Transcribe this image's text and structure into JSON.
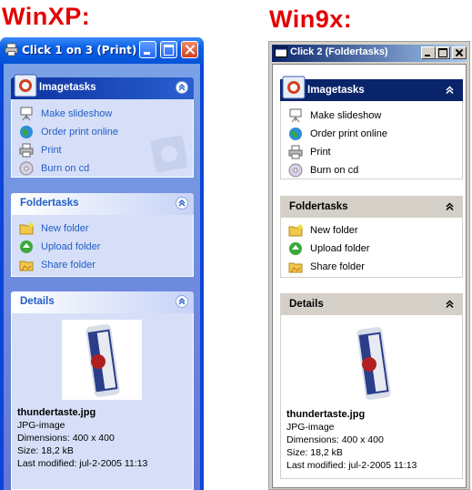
{
  "headings": {
    "xp": "WinXP:",
    "w9x": "Win9x:"
  },
  "xp": {
    "title": "Click 1 on 3 (Print)",
    "imagetasks": {
      "title": "Imagetasks",
      "items": [
        "Make slideshow",
        "Order print online",
        "Print",
        "Burn on cd"
      ]
    },
    "foldertasks": {
      "title": "Foldertasks",
      "items": [
        "New folder",
        "Upload folder",
        "Share folder"
      ]
    },
    "details": {
      "title": "Details",
      "filename": "thundertaste.jpg",
      "type": "JPG-image",
      "dimensions": "Dimensions: 400 x 400",
      "size": "Size: 18,2 kB",
      "modified": "Last modified: jul-2-2005 11:13"
    }
  },
  "w9x": {
    "title": "Click 2 (Foldertasks)",
    "imagetasks": {
      "title": "Imagetasks",
      "items": [
        "Make slideshow",
        "Order print online",
        "Print",
        "Burn on cd"
      ]
    },
    "foldertasks": {
      "title": "Foldertasks",
      "items": [
        "New folder",
        "Upload folder",
        "Share folder"
      ]
    },
    "details": {
      "title": "Details",
      "filename": "thundertaste.jpg",
      "type": "JPG-image",
      "dimensions": "Dimensions: 400 x 400",
      "size": "Size: 18,2 kB",
      "modified": "Last modified: jul-2-2005 11:13"
    }
  },
  "icons": {
    "tasks": [
      "slideshow-icon",
      "globe-icon",
      "printer-icon",
      "cd-icon"
    ],
    "folders": [
      "new-folder-icon",
      "globe-icon",
      "share-folder-icon"
    ]
  },
  "colors": {
    "heading": "#e30000",
    "xp_blue": "#0a46d8",
    "xp_link": "#215dc6",
    "w9_title": "#0a246a",
    "w9_face": "#d4d0c8"
  }
}
